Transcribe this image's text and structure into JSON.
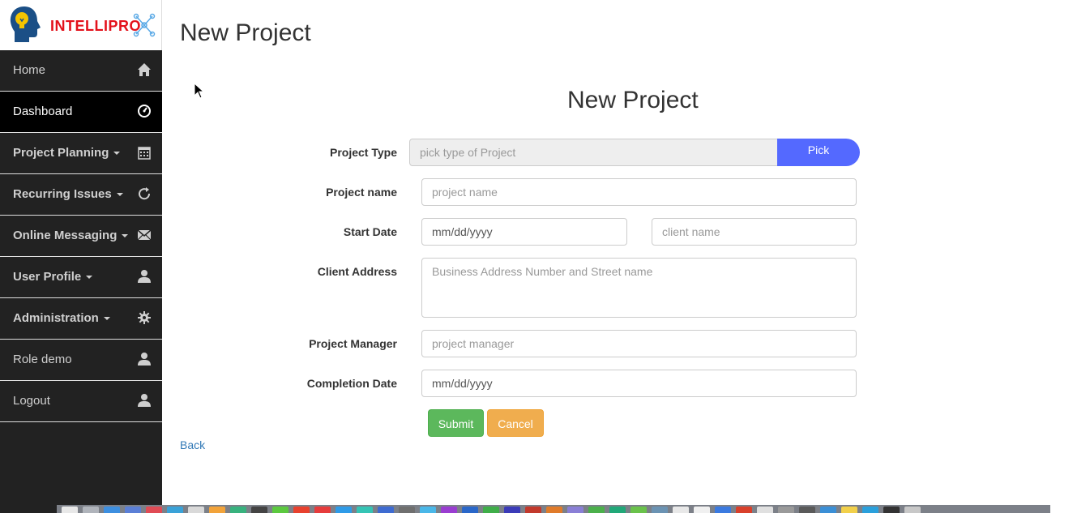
{
  "logo": {
    "text": "INTELLIPRO"
  },
  "sidebar": {
    "items": [
      {
        "label": "Home",
        "icon": "home-icon",
        "active": false,
        "dropdown": false
      },
      {
        "label": "Dashboard",
        "icon": "dashboard-icon",
        "active": true,
        "dropdown": false
      },
      {
        "label": "Project Planning",
        "icon": "calendar-icon",
        "active": false,
        "dropdown": true
      },
      {
        "label": "Recurring Issues",
        "icon": "refresh-icon",
        "active": false,
        "dropdown": true
      },
      {
        "label": "Online Messaging",
        "icon": "envelope-icon",
        "active": false,
        "dropdown": true
      },
      {
        "label": "User Profile",
        "icon": "user-icon",
        "active": false,
        "dropdown": true
      },
      {
        "label": "Administration",
        "icon": "gear-icon",
        "active": false,
        "dropdown": true
      },
      {
        "label": "Role demo",
        "icon": "user-icon",
        "active": false,
        "dropdown": false
      },
      {
        "label": "Logout",
        "icon": "user-icon",
        "active": false,
        "dropdown": false
      }
    ]
  },
  "page": {
    "title": "New Project",
    "back_link": "Back"
  },
  "form": {
    "title": "New Project",
    "project_type": {
      "label": "Project Type",
      "placeholder": "pick type of Project",
      "button": "Pick"
    },
    "project_name": {
      "label": "Project name",
      "placeholder": "project name"
    },
    "start_date": {
      "label": "Start Date",
      "placeholder": "mm/dd/yyyy"
    },
    "client_name": {
      "placeholder": "client name"
    },
    "client_address": {
      "label": "Client Address",
      "placeholder": "Business Address Number and Street name"
    },
    "project_manager": {
      "label": "Project Manager",
      "placeholder": "project manager"
    },
    "completion_date": {
      "label": "Completion Date",
      "placeholder": "mm/dd/yyyy"
    },
    "submit": "Submit",
    "cancel": "Cancel"
  },
  "colors": {
    "sidebar_bg": "#222222",
    "active_bg": "#000000",
    "pick_button": "#5469ff",
    "submit": "#5cb85c",
    "cancel": "#f0ad4e",
    "link": "#337ab7",
    "logo_red": "#e3111b"
  }
}
